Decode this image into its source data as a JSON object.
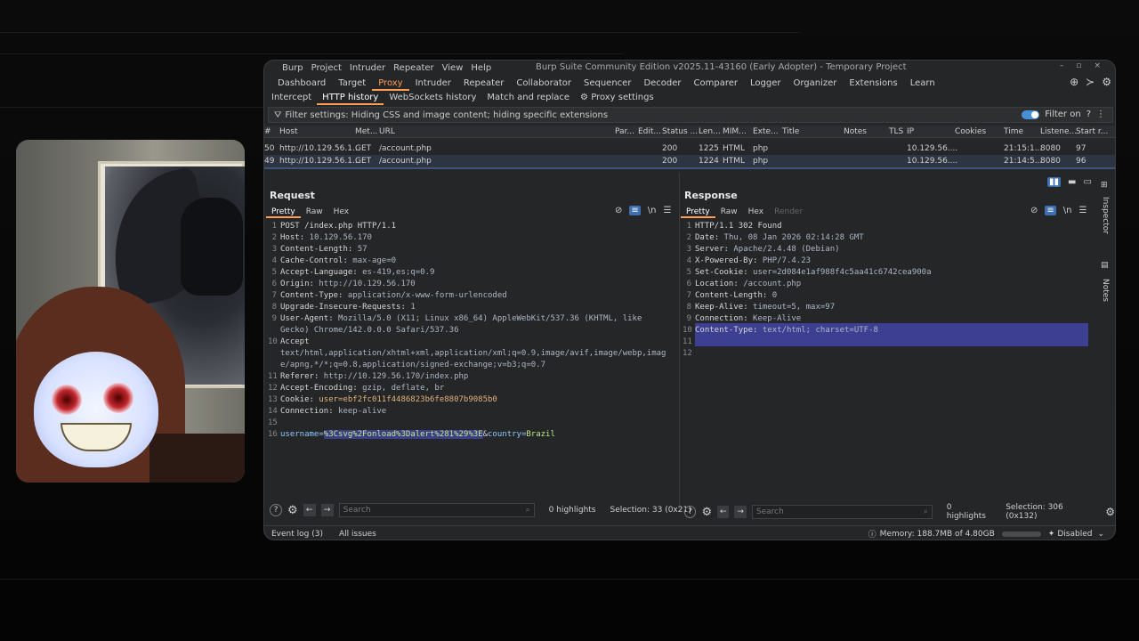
{
  "app": {
    "menus": [
      "Burp",
      "Project",
      "Intruder",
      "Repeater",
      "View",
      "Help"
    ],
    "window_title": "Burp Suite Community Edition v2025.11-43160 (Early Adopter) - Temporary Project",
    "window_controls": [
      "–",
      "▫",
      "×"
    ],
    "top_tabs": [
      "Dashboard",
      "Target",
      "Proxy",
      "Intruder",
      "Repeater",
      "Collaborator",
      "Sequencer",
      "Decoder",
      "Comparer",
      "Logger",
      "Organizer",
      "Extensions",
      "Learn"
    ],
    "active_top_tab": "Proxy",
    "sub_tabs": [
      "Intercept",
      "HTTP history",
      "WebSockets history",
      "Match and replace"
    ],
    "active_sub_tab": "HTTP history",
    "proxy_settings": "Proxy settings"
  },
  "filter": {
    "text": "Filter settings: Hiding CSS and image content; hiding specific extensions",
    "toggle_label": "Filter on"
  },
  "history": {
    "columns": [
      "#",
      "Host",
      "Met...",
      "URL",
      "Par...",
      "Edit...",
      "Status ...",
      "Len...",
      "MIM...",
      "Exte...",
      "Title",
      "Notes",
      "TLS",
      "IP",
      "Cookies",
      "Time",
      "Listene...",
      "Start r..."
    ],
    "rows": [
      {
        "num": "50",
        "host": "http://10.129.56.1...",
        "method": "GET",
        "url": "/account.php",
        "status": "200",
        "length": "1225",
        "mime": "HTML",
        "ext": "php",
        "ip": "10.129.56....",
        "time": "21:15:1...",
        "listener": "8080",
        "start": "97"
      },
      {
        "num": "49",
        "host": "http://10.129.56.1...",
        "method": "GET",
        "url": "/account.php",
        "status": "200",
        "length": "1224",
        "mime": "HTML",
        "ext": "php",
        "ip": "10.129.56....",
        "time": "21:14:5...",
        "listener": "8080",
        "start": "96"
      }
    ]
  },
  "request": {
    "title": "Request",
    "tabs": [
      "Pretty",
      "Raw",
      "Hex"
    ],
    "lines": [
      {
        "n": "1",
        "k": "POST /index.php HTTP/1.1",
        "v": ""
      },
      {
        "n": "2",
        "k": "Host",
        "v": "10.129.56.170"
      },
      {
        "n": "3",
        "k": "Content-Length",
        "v": "57"
      },
      {
        "n": "4",
        "k": "Cache-Control",
        "v": "max-age=0"
      },
      {
        "n": "5",
        "k": "Accept-Language",
        "v": "es-419,es;q=0.9"
      },
      {
        "n": "6",
        "k": "Origin",
        "v": "http://10.129.56.170"
      },
      {
        "n": "7",
        "k": "Content-Type",
        "v": "application/x-www-form-urlencoded"
      },
      {
        "n": "8",
        "k": "Upgrade-Insecure-Requests",
        "v": "1"
      },
      {
        "n": "9",
        "k": "User-Agent",
        "v": "Mozilla/5.0 (X11; Linux x86_64) AppleWebKit/537.36 (KHTML, like"
      },
      {
        "n": "",
        "k": "",
        "v": "Gecko) Chrome/142.0.0.0 Safari/537.36"
      },
      {
        "n": "10",
        "k": "Accept",
        "v": ""
      },
      {
        "n": "",
        "k": "",
        "v": "text/html,application/xhtml+xml,application/xml;q=0.9,image/avif,image/webp,imag"
      },
      {
        "n": "",
        "k": "",
        "v": "e/apng,*/*;q=0.8,application/signed-exchange;v=b3;q=0.7"
      },
      {
        "n": "11",
        "k": "Referer",
        "v": "http://10.129.56.170/index.php"
      },
      {
        "n": "12",
        "k": "Accept-Encoding",
        "v": "gzip, deflate, br"
      },
      {
        "n": "13",
        "k": "Cookie",
        "v": "user=ebf2fc011f4486823b6fe8807b9085b0"
      },
      {
        "n": "14",
        "k": "Connection",
        "v": "keep-alive"
      },
      {
        "n": "15",
        "k": "",
        "v": ""
      }
    ],
    "body_line_num": "16",
    "body_param1": "username",
    "body_value1": "%3Csvg%2Fonload%3Dalert%281%29%3E",
    "body_amp": "&",
    "body_param2": "country",
    "body_value2": "Brazil",
    "search_placeholder": "Search",
    "highlights": "0 highlights",
    "selection": "Selection: 33 (0x21)"
  },
  "response": {
    "title": "Response",
    "tabs": [
      "Pretty",
      "Raw",
      "Hex",
      "Render"
    ],
    "lines": [
      {
        "n": "1",
        "k": "HTTP/1.1 302 Found",
        "v": ""
      },
      {
        "n": "2",
        "k": "Date",
        "v": "Thu, 08 Jan 2026 02:14:28 GMT"
      },
      {
        "n": "3",
        "k": "Server",
        "v": "Apache/2.4.48 (Debian)"
      },
      {
        "n": "4",
        "k": "X-Powered-By",
        "v": "PHP/7.4.23"
      },
      {
        "n": "5",
        "k": "Set-Cookie",
        "v": "user=2d084e1af988f4c5aa41c6742cea900a"
      },
      {
        "n": "6",
        "k": "Location",
        "v": "/account.php"
      },
      {
        "n": "7",
        "k": "Content-Length",
        "v": "0"
      },
      {
        "n": "8",
        "k": "Keep-Alive",
        "v": "timeout=5, max=97"
      },
      {
        "n": "9",
        "k": "Connection",
        "v": "Keep-Alive"
      },
      {
        "n": "10",
        "k": "Content-Type",
        "v": "text/html; charset=UTF-8"
      },
      {
        "n": "11",
        "k": "",
        "v": ""
      },
      {
        "n": "12",
        "k": "",
        "v": ""
      }
    ],
    "search_placeholder": "Search",
    "highlights": "0 highlights",
    "selection": "Selection: 306 (0x132)"
  },
  "side_rail": {
    "inspector": "Inspector",
    "notes": "Notes"
  },
  "status": {
    "event_log": "Event log (3)",
    "all_issues": "All issues",
    "memory": "Memory: 188.7MB of 4.80GB",
    "disabled": "Disabled"
  },
  "colors": {
    "accent": "#ff9c55",
    "selection": "#3d3f92",
    "toggle": "#4a8fd6"
  }
}
